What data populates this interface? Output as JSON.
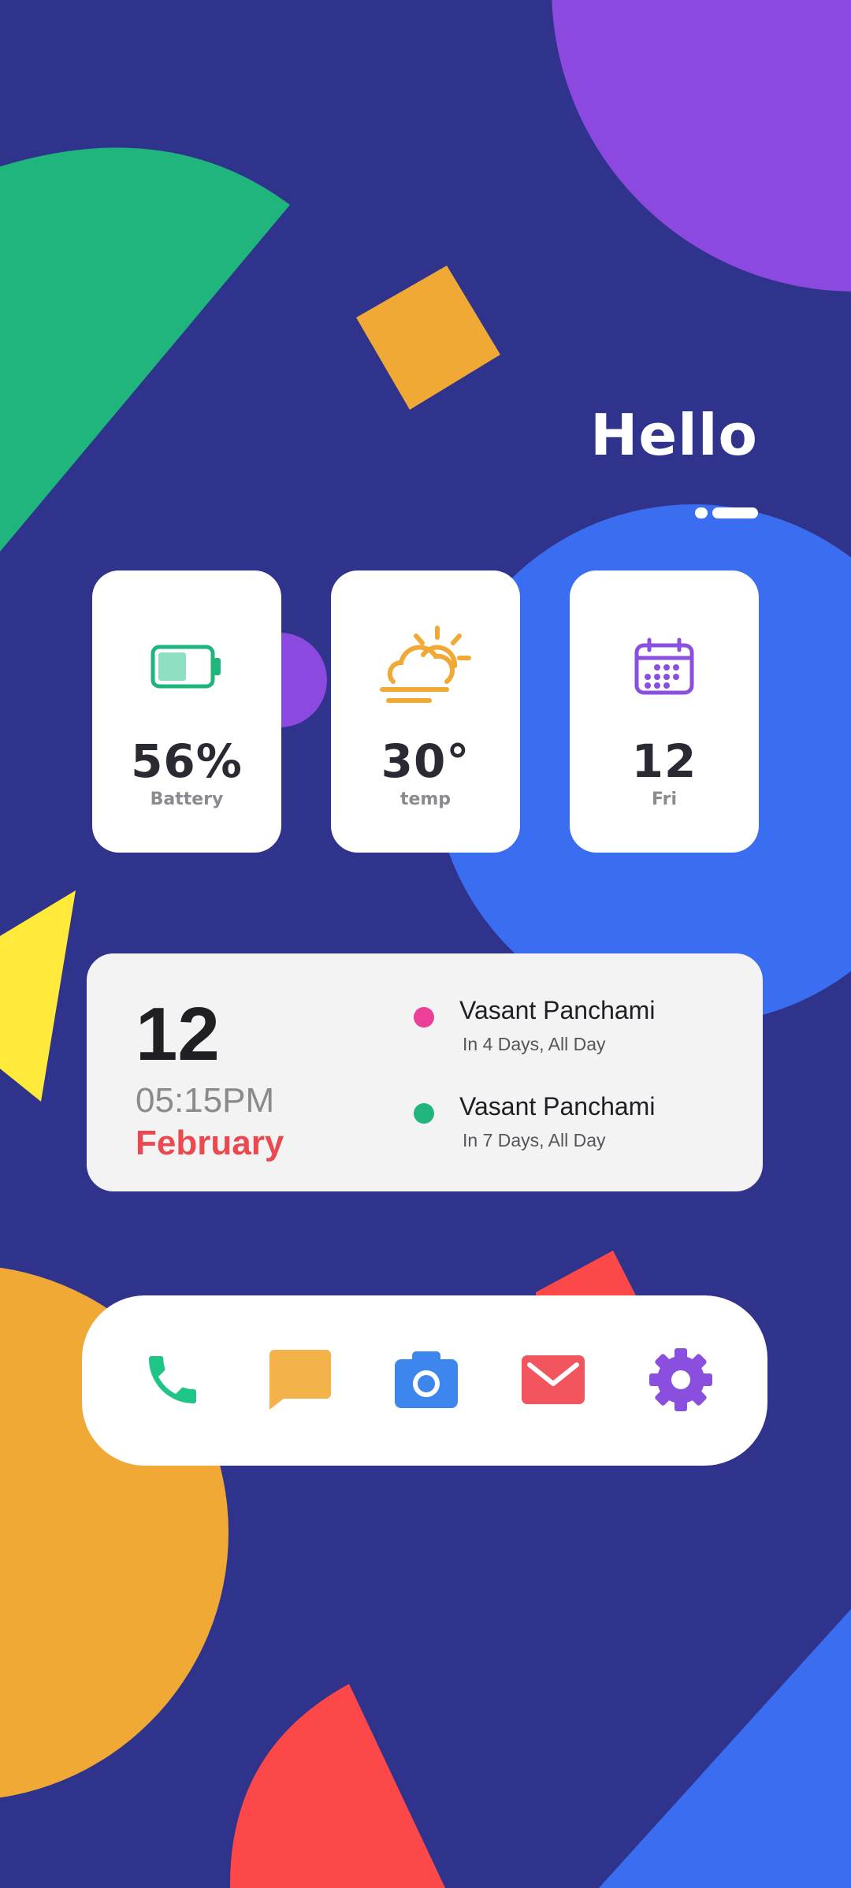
{
  "greeting": "Hello",
  "widgets": {
    "battery": {
      "value": "56%",
      "label": "Battery",
      "level": 0.56,
      "color": "#1fb57d"
    },
    "weather": {
      "value": "30°",
      "label": "temp",
      "icon": "partly-cloudy-icon",
      "color": "#f0a935"
    },
    "date": {
      "value": "12",
      "label": "Fri",
      "icon": "calendar-icon",
      "color": "#8b4fe0"
    }
  },
  "calendar": {
    "day": "12",
    "time": "05:15PM",
    "month": "February",
    "events": [
      {
        "title": "Vasant Panchami",
        "subtitle": "In 4 Days, All Day",
        "color": "#ec3f97"
      },
      {
        "title": "Vasant Panchami",
        "subtitle": "In 7 Days, All Day",
        "color": "#1fb57d"
      }
    ]
  },
  "dock": {
    "apps": [
      {
        "name": "phone",
        "icon": "phone-icon",
        "color": "#1fc587"
      },
      {
        "name": "messages",
        "icon": "message-icon",
        "color": "#f4b24a"
      },
      {
        "name": "camera",
        "icon": "camera-icon",
        "color": "#3c86ee"
      },
      {
        "name": "mail",
        "icon": "mail-icon",
        "color": "#f2555e"
      },
      {
        "name": "settings",
        "icon": "gear-icon",
        "color": "#8b4fe0"
      }
    ]
  },
  "colors": {
    "background": "#2f338b",
    "purple": "#8b49e0",
    "green": "#1fb57d",
    "orange": "#f0a935",
    "blue": "#3a6df0",
    "yellow": "#ffe93a",
    "red": "#fc4848"
  }
}
